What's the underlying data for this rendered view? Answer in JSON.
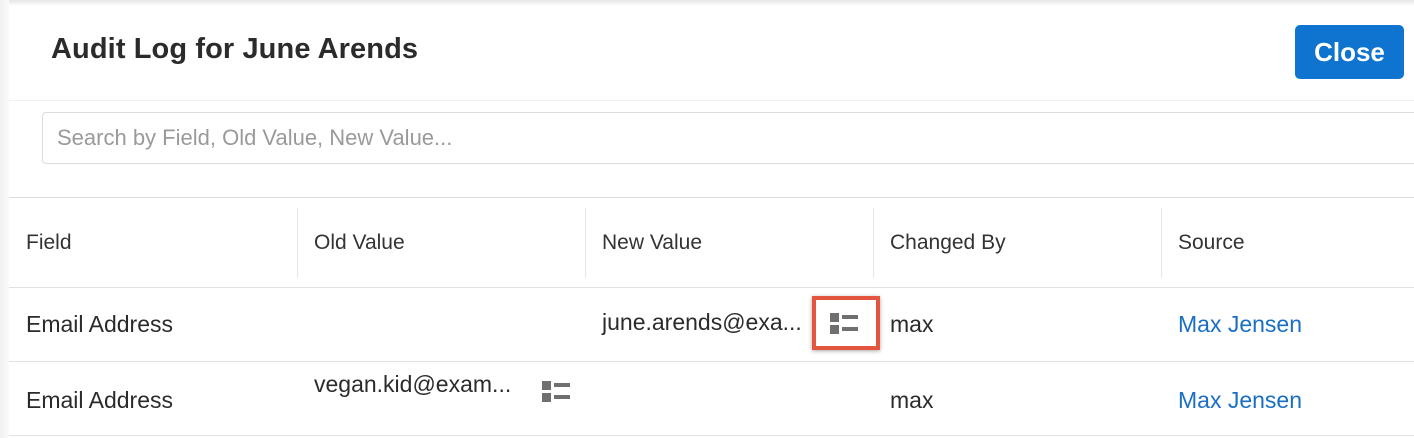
{
  "dialog": {
    "title": "Audit Log for June Arends",
    "close_label": "Close"
  },
  "search": {
    "placeholder": "Search by Field, Old Value, New Value...",
    "value": ""
  },
  "table": {
    "columns": [
      "Field",
      "Old Value",
      "New Value",
      "Changed By",
      "Source"
    ],
    "rows": [
      {
        "field": "Email Address",
        "old_value": "",
        "new_value": "june.arends@exa...",
        "changed_by": "max",
        "source": "Max Jensen"
      },
      {
        "field": "Email Address",
        "old_value": "vegan.kid@exam...",
        "new_value": "",
        "changed_by": "max",
        "source": "Max Jensen"
      }
    ]
  },
  "icons": {
    "detail": "detail-view-icon"
  },
  "colors": {
    "accent": "#0e74d0",
    "link": "#1a6fc4",
    "highlight": "#e4553f"
  }
}
